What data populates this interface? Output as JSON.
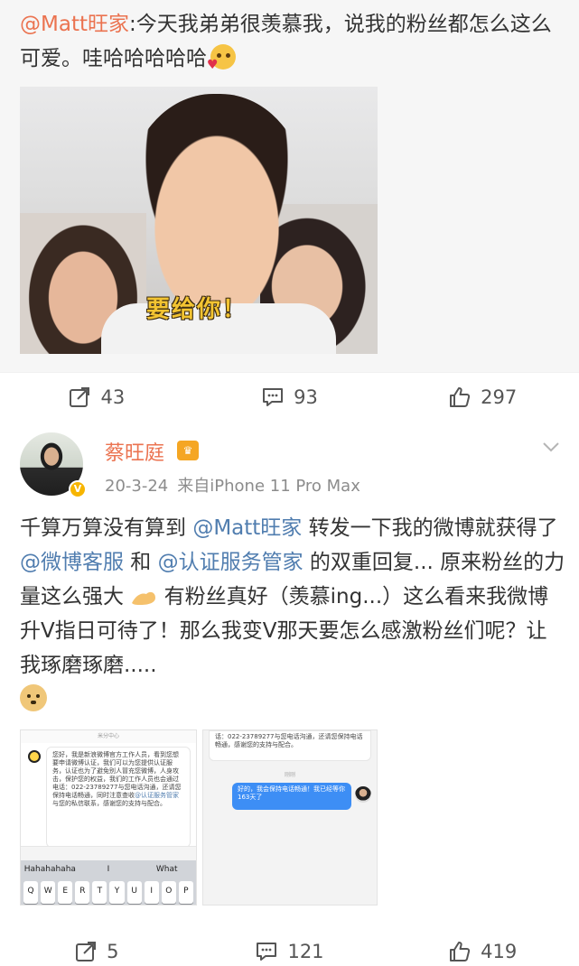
{
  "repost": {
    "mention": "@Matt旺家",
    "text": ":今天我弟弟很羡慕我，说我的粉丝都怎么这么可爱。哇哈哈哈哈哈",
    "gif_subtitle": "要给你！",
    "actions": {
      "reposts": "43",
      "comments": "93",
      "likes": "297"
    }
  },
  "post": {
    "username": "蔡旺庭",
    "date": "20-3-24",
    "source": "来自iPhone 11 Pro Max",
    "body": {
      "p1": "千算万算没有算到 ",
      "mention1": "@Matt旺家",
      "p2": " 转发一下我的微博就获得了",
      "link1": "@微博客服",
      "p3": " 和 ",
      "link2": "@认证服务管家",
      "p4": " 的双重回复... 原来粉丝的力量这么强大 ",
      "p5": " 有粉丝真好（羡慕ing...）这么看来我微博升Ⅴ指日可待了！那么我变Ⅴ那天要怎么感激粉丝们呢？让我琢磨琢磨....."
    },
    "screenshot1": {
      "header": "米分中心",
      "message": "您好，我是新浪微博官方工作人员，看到您想要申请微博认证，我们可以为您提供认证服务，认证也为了避免别人冒充您微博，人身攻击，保护您的权益，我们的工作人员也会通过电话：022-23789277与您电话沟通，还请您保持电话畅通，同时注意查收",
      "message_link": "@认证服务管家",
      "message_tail": "与您的私信联系，感谢您的支持与配合。",
      "suggestions": [
        "Hahahahaha",
        "I",
        "What"
      ],
      "keys": [
        "Q",
        "W",
        "E",
        "R",
        "T",
        "Y",
        "U",
        "I",
        "O",
        "P"
      ]
    },
    "screenshot2": {
      "bubble_top": "话：022-23789277与您电话沟通，还请您保持电话畅通，感谢您的支持与配合。",
      "separator": "刚刚",
      "reply": "好的，我会保持电话畅通！我已经等你163天了"
    },
    "actions": {
      "reposts": "5",
      "comments": "121",
      "likes": "419"
    }
  },
  "icons": {
    "repost": "repost-icon",
    "comment": "comment-icon",
    "like": "like-icon",
    "chevron": "chevron-down-icon"
  },
  "colors": {
    "mention": "#eb7350",
    "link": "#507daf",
    "repost_bg": "#f6f6f6"
  }
}
